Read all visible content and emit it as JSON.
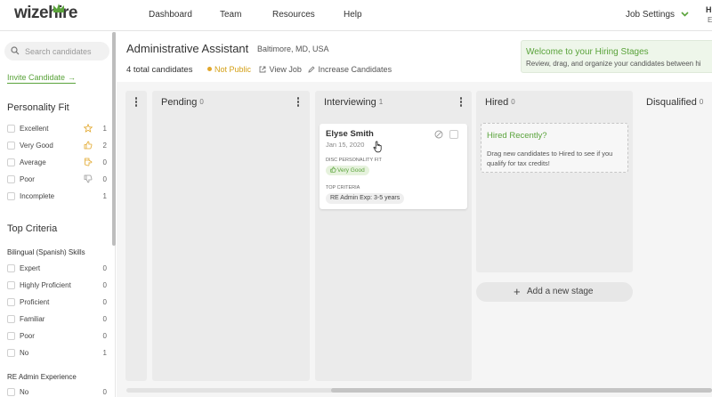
{
  "app": {
    "logo": "wizehire",
    "accent": "#5aa33b"
  },
  "nav": {
    "links": [
      "Dashboard",
      "Team",
      "Resources",
      "Help"
    ],
    "job_settings": "Job Settings",
    "user_initial": "H",
    "user_sub": "E"
  },
  "sidebar": {
    "search_placeholder": "Search candidates",
    "invite": "Invite Candidate",
    "personality_title": "Personality Fit",
    "personality": [
      {
        "label": "Excellent",
        "icon": "star-icon",
        "count": "1"
      },
      {
        "label": "Very Good",
        "icon": "thumbs-up-icon",
        "count": "2"
      },
      {
        "label": "Average",
        "icon": "thumbs-sideways-icon",
        "count": "0"
      },
      {
        "label": "Poor",
        "icon": "thumbs-down-icon",
        "count": "0"
      },
      {
        "label": "Incomplete",
        "icon": "",
        "count": "1"
      }
    ],
    "criteria_title": "Top Criteria",
    "group1_title": "Bilingual (Spanish) Skills",
    "group1": [
      {
        "label": "Expert",
        "count": "0"
      },
      {
        "label": "Highly Proficient",
        "count": "0"
      },
      {
        "label": "Proficient",
        "count": "0"
      },
      {
        "label": "Familiar",
        "count": "0"
      },
      {
        "label": "Poor",
        "count": "0"
      },
      {
        "label": "No",
        "count": "1"
      }
    ],
    "group2_title": "RE Admin Experience",
    "group2": [
      {
        "label": "No",
        "count": "0"
      }
    ]
  },
  "job": {
    "title": "Administrative Assistant",
    "location": "Baltimore, MD, USA",
    "total": "4 total candidates",
    "status": "Not Public",
    "view_job": "View Job",
    "increase": "Increase Candidates"
  },
  "welcome": {
    "title": "Welcome to your Hiring Stages",
    "subtitle": "Review, drag, and organize your candidates between hi"
  },
  "stages": [
    {
      "name": "Pending",
      "count": "0"
    },
    {
      "name": "Interviewing",
      "count": "1"
    },
    {
      "name": "Hired",
      "count": "0"
    },
    {
      "name": "Disqualified",
      "count": "0"
    }
  ],
  "card": {
    "name": "Elyse Smith",
    "date": "Jan 15, 2020",
    "disc_caption": "DISC PERSONALITY FIT",
    "fit": "Very Good",
    "criteria_caption": "TOP CRITERIA",
    "criteria": "RE Admin Exp: 3-5 years"
  },
  "hired_box": {
    "title": "Hired Recently?",
    "desc": "Drag new candidates to Hired to see if you qualify for tax credits!"
  },
  "add_stage": "Add a new stage"
}
